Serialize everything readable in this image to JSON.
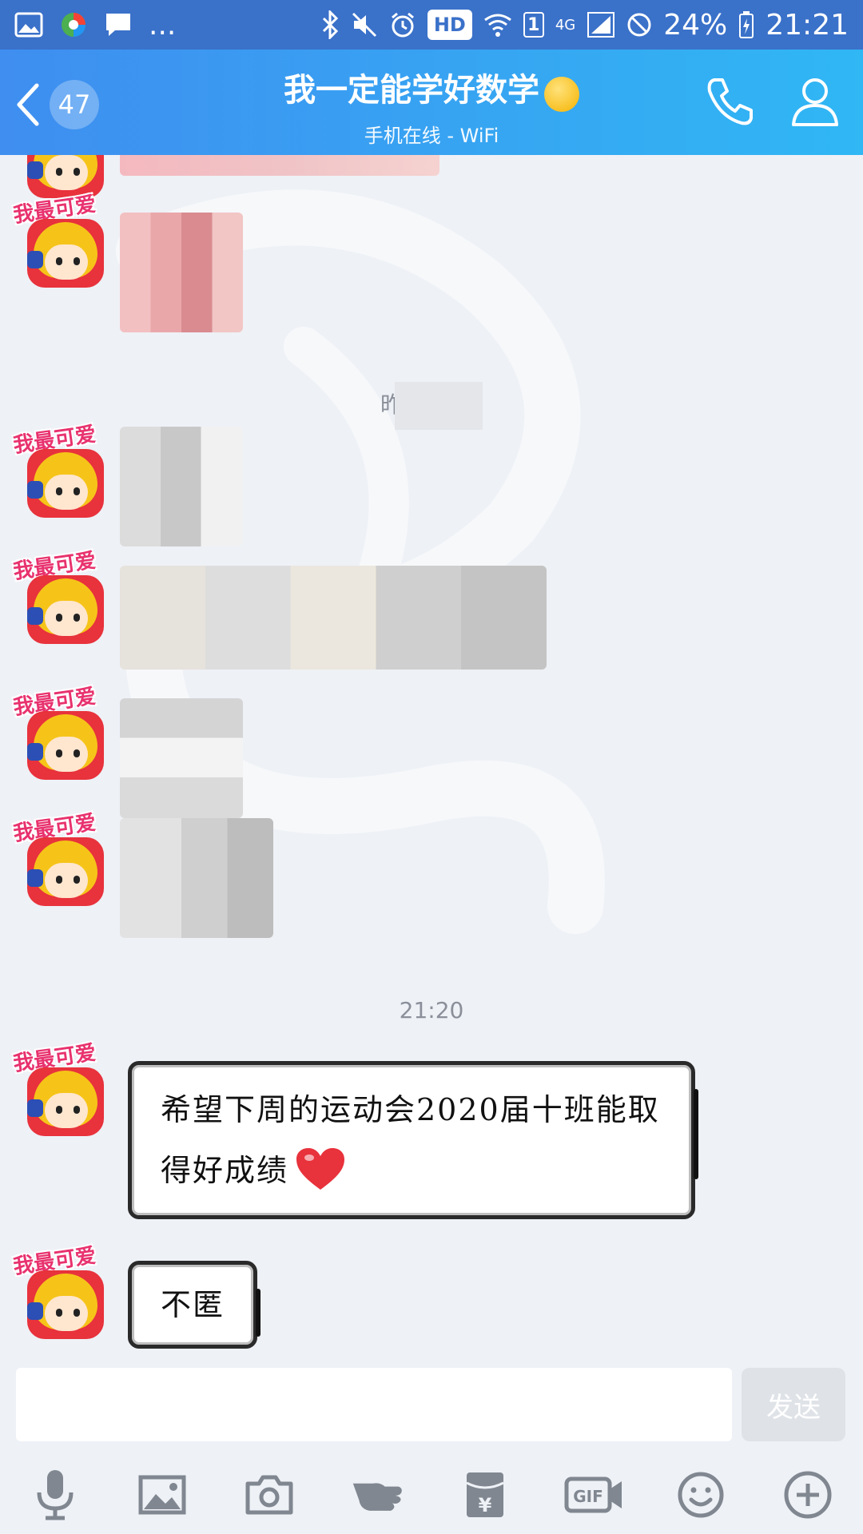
{
  "status_bar": {
    "dots": "...",
    "hd": "HD",
    "sim": "1",
    "network": "4G",
    "battery": "24%",
    "time": "21:21",
    "icons": [
      "gallery-icon",
      "browser-icon",
      "message-icon",
      "bluetooth-icon",
      "mute-icon",
      "alarm-icon",
      "wifi-icon",
      "signal-icon",
      "dnd-icon",
      "battery-icon"
    ]
  },
  "header": {
    "unread_count": "47",
    "title": "我一定能学好数学",
    "title_emoji": "thinking-face-icon",
    "subtitle": "手机在线 - WiFi",
    "gradient_start": "#3f8ef0",
    "gradient_end": "#30b7f4"
  },
  "messages": {
    "avatar_label": "我最可爱",
    "timestamp_blurred": "昨",
    "timestamp_recent": "21:20",
    "bubble_1": "希望下周的运动会2020届十班能取得好成绩",
    "bubble_2": "不匿"
  },
  "input": {
    "placeholder": "",
    "send_label": "发送"
  },
  "toolbar": {
    "items": [
      "microphone-icon",
      "image-icon",
      "camera-icon",
      "poke-icon",
      "red-packet-icon",
      "gif-icon",
      "emoji-icon",
      "plus-icon"
    ],
    "gif_text": "GIF",
    "yen": "¥"
  },
  "colors": {
    "status_bar": "#3a71c9",
    "chat_background": "#eef1f6",
    "send_disabled": "#dfe3e8",
    "heart": "#e8323c"
  }
}
